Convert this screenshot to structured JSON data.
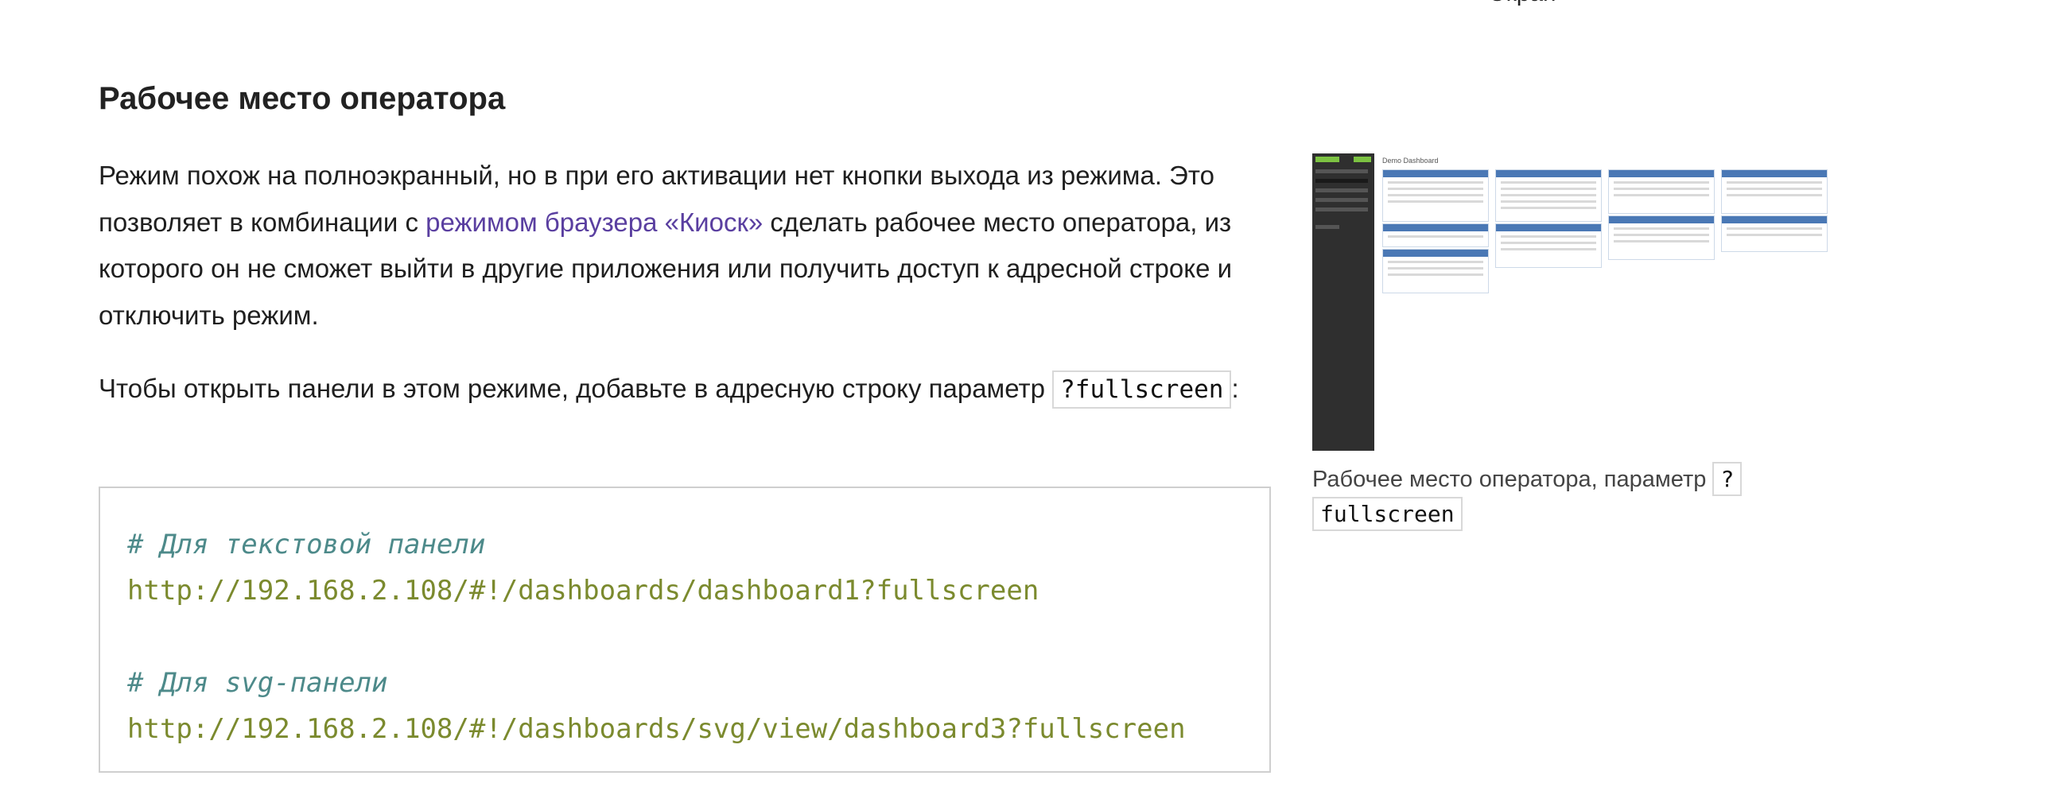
{
  "top_fragment": "Экран",
  "section": {
    "title": "Рабочее место оператора"
  },
  "paragraph1": {
    "before_link": "Режим похож на полноэкранный, но в при его активации нет кнопки выхода из режима. Это позволяет в комбинации с ",
    "link_text": "режимом браузера «Киоск»",
    "after_link": " сделать рабочее место оператора, из которого он не сможет выйти в другие приложения или получить доступ к адресной строке и отключить режим."
  },
  "paragraph2": {
    "text": "Чтобы открыть панели в этом режиме, добавьте в адресную строку параметр ",
    "code": "?fullscreen",
    "suffix": ":"
  },
  "code_block": {
    "comment1": "# Для текстовой панели",
    "url1": "http://192.168.2.108/#!/dashboards/dashboard1?fullscreen",
    "comment2": "# Для svg-панели",
    "url2": "http://192.168.2.108/#!/dashboards/svg/view/dashboard3?fullscreen"
  },
  "figure": {
    "thumbnail_title": "Demo Dashboard",
    "caption_text": "Рабочее место оператора, параметр ",
    "caption_code": "?fullscreen"
  },
  "colors": {
    "link": "#5a3fa0",
    "code_comment": "#4d8a8a",
    "code_url": "#7b8a2e",
    "panel_header": "#4a78b5",
    "sidebar": "#2f2f2f",
    "logo_green": "#7cc242"
  }
}
